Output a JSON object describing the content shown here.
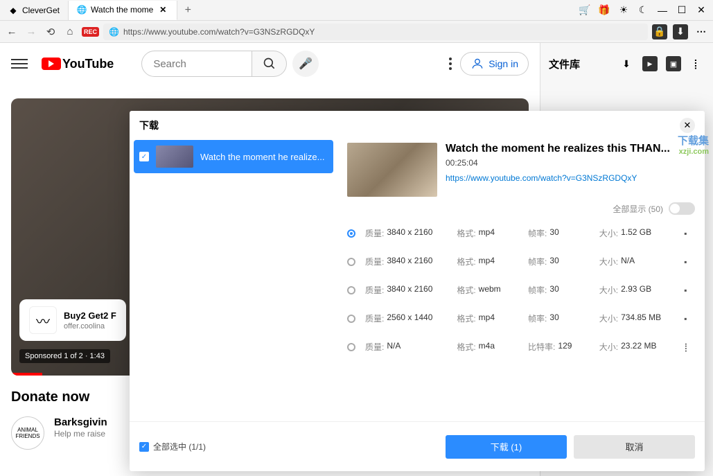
{
  "tabs": {
    "inactive": "CleverGet",
    "active": "Watch the mome",
    "close_glyph": "✕",
    "add_glyph": "+"
  },
  "title_icons": {
    "cart": "🛒",
    "gift": "🎁",
    "sun": "☀",
    "moon": "☾"
  },
  "window": {
    "min": "—",
    "max": "☐",
    "close": "✕"
  },
  "addr": {
    "back": "←",
    "forward": "→",
    "reload": "⟲",
    "home": "⌂",
    "rec": "REC",
    "url": "https://www.youtube.com/watch?v=G3NSzRGDQxY",
    "lock": "🔒",
    "dl": "⬇",
    "more": "⋯"
  },
  "yt": {
    "logo_text": "YouTube",
    "search_placeholder": "Search",
    "signin": "Sign in"
  },
  "video": {
    "sponsor_title": "Buy2 Get2 F",
    "sponsor_sub": "offer.coolina",
    "sponsor_label": "Sponsored 1 of 2 · 1:43"
  },
  "donate": {
    "heading": "Donate now",
    "title": "Barksgivin",
    "sub": "Help me raise"
  },
  "sidebar": {
    "title": "文件库",
    "dl": "⬇",
    "play": "▶",
    "cam": "▣",
    "audio": "⡇"
  },
  "modal": {
    "title": "下载",
    "item_title": "Watch the moment he realize...",
    "meta_title": "Watch the moment he realizes this THAN...",
    "duration": "00:25:04",
    "url": "https://www.youtube.com/watch?v=G3NSzRGDQxY",
    "show_all": "全部显示  (50)",
    "labels": {
      "quality": "质量:",
      "format": "格式:",
      "fps": "帧率:",
      "bitrate": "比特率:",
      "size": "大小:"
    },
    "formats": [
      {
        "selected": true,
        "quality": "3840 x 2160",
        "format": "mp4",
        "rate_label": "fps",
        "rate": "30",
        "size": "1.52 GB",
        "icon": "▪"
      },
      {
        "selected": false,
        "quality": "3840 x 2160",
        "format": "mp4",
        "rate_label": "fps",
        "rate": "30",
        "size": "N/A",
        "icon": "▪"
      },
      {
        "selected": false,
        "quality": "3840 x 2160",
        "format": "webm",
        "rate_label": "fps",
        "rate": "30",
        "size": "2.93 GB",
        "icon": "▪"
      },
      {
        "selected": false,
        "quality": "2560 x 1440",
        "format": "mp4",
        "rate_label": "fps",
        "rate": "30",
        "size": "734.85 MB",
        "icon": "▪"
      },
      {
        "selected": false,
        "quality": "N/A",
        "format": "m4a",
        "rate_label": "bitrate",
        "rate": "129",
        "size": "23.22 MB",
        "icon": "⡇"
      }
    ],
    "select_all": "全部选中   (1/1)",
    "download_btn": "下载 (1)",
    "cancel_btn": "取消"
  },
  "watermark": {
    "line1": "下载集",
    "line2": "xzji.com"
  }
}
